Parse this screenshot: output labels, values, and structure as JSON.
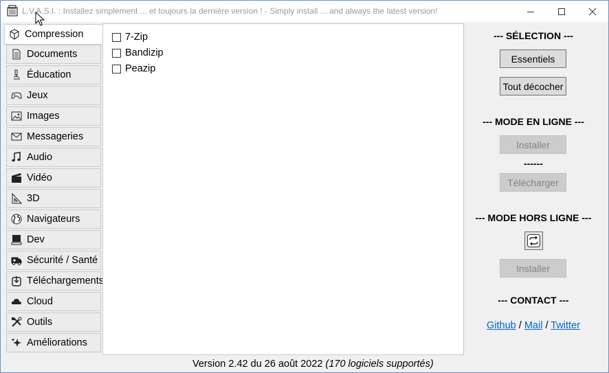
{
  "window": {
    "title": "L.V.A.S.I. : Installez simplement ... et toujours la dernière version ! - Simply install ... and always the latest version!",
    "minimize_icon": "minimize-icon",
    "maximize_icon": "maximize-icon",
    "close_icon": "close-icon"
  },
  "tabs": [
    {
      "label": "Compression",
      "icon": "box-icon",
      "active": true
    },
    {
      "label": "Documents",
      "icon": "document-icon"
    },
    {
      "label": "Éducation",
      "icon": "microscope-icon"
    },
    {
      "label": "Jeux",
      "icon": "gamepad-icon"
    },
    {
      "label": "Images",
      "icon": "image-icon"
    },
    {
      "label": "Messageries",
      "icon": "envelope-icon"
    },
    {
      "label": "Audio",
      "icon": "music-note-icon"
    },
    {
      "label": "Vidéo",
      "icon": "clapperboard-icon"
    },
    {
      "label": "3D",
      "icon": "set-square-icon"
    },
    {
      "label": "Navigateurs",
      "icon": "globe-icon"
    },
    {
      "label": "Dev",
      "icon": "computer-icon"
    },
    {
      "label": "Sécurité / Santé",
      "icon": "ambulance-icon"
    },
    {
      "label": "Téléchargements",
      "icon": "download-icon"
    },
    {
      "label": "Cloud",
      "icon": "cloud-icon"
    },
    {
      "label": "Outils",
      "icon": "tools-icon"
    },
    {
      "label": "Améliorations",
      "icon": "sparkle-icon"
    }
  ],
  "software": [
    {
      "label": "7-Zip",
      "checked": false
    },
    {
      "label": "Bandizip",
      "checked": false
    },
    {
      "label": "Peazip",
      "checked": false
    }
  ],
  "side": {
    "selection_title": "--- SÉLECTION ---",
    "essentials_label": "Essentiels",
    "uncheck_all_label": "Tout décocher",
    "online_title": "--- MODE EN LIGNE ---",
    "online_install_label": "Installer",
    "separator": "------",
    "download_label": "Télécharger",
    "offline_title": "--- MODE HORS LIGNE ---",
    "refresh_icon": "refresh-icon",
    "offline_install_label": "Installer",
    "contact_title": "--- CONTACT ---",
    "link_github": "Github",
    "link_mail": "Mail",
    "link_twitter": "Twitter",
    "link_sep": " / "
  },
  "footer": {
    "version": "Version 2.42 du 26 août 2022",
    "supported": "(170 logiciels supportés)"
  }
}
